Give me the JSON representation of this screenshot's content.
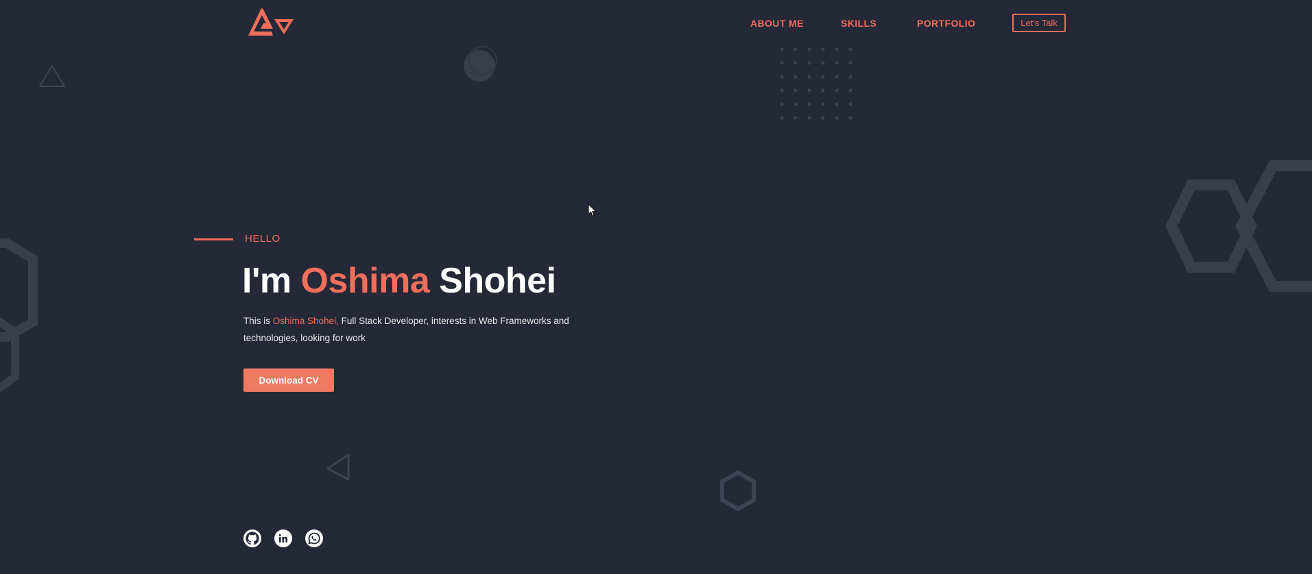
{
  "nav": {
    "links": [
      {
        "label": "ABOUT ME"
      },
      {
        "label": "SKILLS"
      },
      {
        "label": "PORTFOLIO"
      }
    ],
    "cta_label": "Let's Talk"
  },
  "hero": {
    "greeting": "HELLO",
    "headline_prefix": "I'm",
    "headline_accent": "Oshima",
    "headline_suffix": "Shohei",
    "desc_prefix": "This is",
    "desc_name": "Oshima Shohei,",
    "desc_rest": "Full Stack Developer, interests in Web Frameworks and technologies, looking for work",
    "cv_button": "Download CV"
  },
  "social": [
    {
      "icon": "github-icon"
    },
    {
      "icon": "linkedin-icon"
    },
    {
      "icon": "whatsapp-icon"
    }
  ],
  "colors": {
    "background": "#252836",
    "accent": "#ef6f5c",
    "text": "#ffffff",
    "decor": "#3b3e4c"
  }
}
